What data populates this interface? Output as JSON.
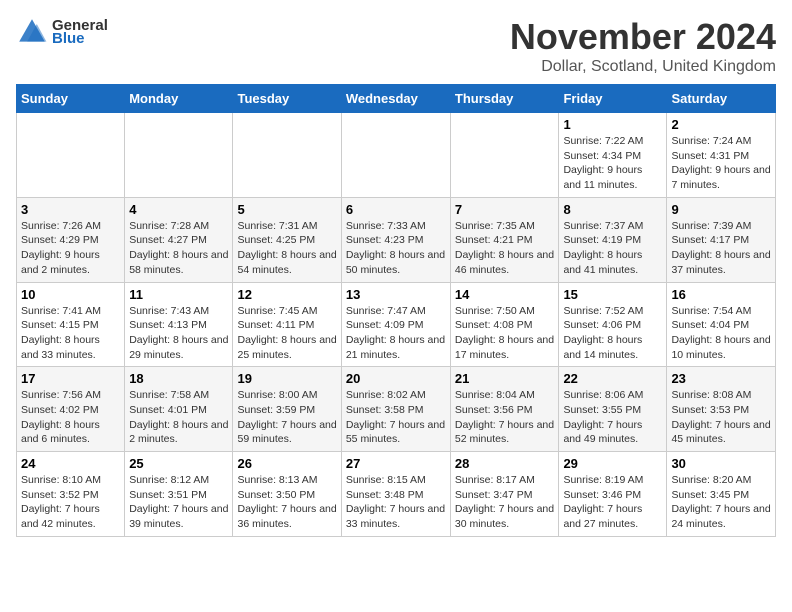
{
  "header": {
    "logo_general": "General",
    "logo_blue": "Blue",
    "month_title": "November 2024",
    "location": "Dollar, Scotland, United Kingdom"
  },
  "days_of_week": [
    "Sunday",
    "Monday",
    "Tuesday",
    "Wednesday",
    "Thursday",
    "Friday",
    "Saturday"
  ],
  "weeks": [
    [
      {
        "day": "",
        "info": ""
      },
      {
        "day": "",
        "info": ""
      },
      {
        "day": "",
        "info": ""
      },
      {
        "day": "",
        "info": ""
      },
      {
        "day": "",
        "info": ""
      },
      {
        "day": "1",
        "info": "Sunrise: 7:22 AM\nSunset: 4:34 PM\nDaylight: 9 hours and 11 minutes."
      },
      {
        "day": "2",
        "info": "Sunrise: 7:24 AM\nSunset: 4:31 PM\nDaylight: 9 hours and 7 minutes."
      }
    ],
    [
      {
        "day": "3",
        "info": "Sunrise: 7:26 AM\nSunset: 4:29 PM\nDaylight: 9 hours and 2 minutes."
      },
      {
        "day": "4",
        "info": "Sunrise: 7:28 AM\nSunset: 4:27 PM\nDaylight: 8 hours and 58 minutes."
      },
      {
        "day": "5",
        "info": "Sunrise: 7:31 AM\nSunset: 4:25 PM\nDaylight: 8 hours and 54 minutes."
      },
      {
        "day": "6",
        "info": "Sunrise: 7:33 AM\nSunset: 4:23 PM\nDaylight: 8 hours and 50 minutes."
      },
      {
        "day": "7",
        "info": "Sunrise: 7:35 AM\nSunset: 4:21 PM\nDaylight: 8 hours and 46 minutes."
      },
      {
        "day": "8",
        "info": "Sunrise: 7:37 AM\nSunset: 4:19 PM\nDaylight: 8 hours and 41 minutes."
      },
      {
        "day": "9",
        "info": "Sunrise: 7:39 AM\nSunset: 4:17 PM\nDaylight: 8 hours and 37 minutes."
      }
    ],
    [
      {
        "day": "10",
        "info": "Sunrise: 7:41 AM\nSunset: 4:15 PM\nDaylight: 8 hours and 33 minutes."
      },
      {
        "day": "11",
        "info": "Sunrise: 7:43 AM\nSunset: 4:13 PM\nDaylight: 8 hours and 29 minutes."
      },
      {
        "day": "12",
        "info": "Sunrise: 7:45 AM\nSunset: 4:11 PM\nDaylight: 8 hours and 25 minutes."
      },
      {
        "day": "13",
        "info": "Sunrise: 7:47 AM\nSunset: 4:09 PM\nDaylight: 8 hours and 21 minutes."
      },
      {
        "day": "14",
        "info": "Sunrise: 7:50 AM\nSunset: 4:08 PM\nDaylight: 8 hours and 17 minutes."
      },
      {
        "day": "15",
        "info": "Sunrise: 7:52 AM\nSunset: 4:06 PM\nDaylight: 8 hours and 14 minutes."
      },
      {
        "day": "16",
        "info": "Sunrise: 7:54 AM\nSunset: 4:04 PM\nDaylight: 8 hours and 10 minutes."
      }
    ],
    [
      {
        "day": "17",
        "info": "Sunrise: 7:56 AM\nSunset: 4:02 PM\nDaylight: 8 hours and 6 minutes."
      },
      {
        "day": "18",
        "info": "Sunrise: 7:58 AM\nSunset: 4:01 PM\nDaylight: 8 hours and 2 minutes."
      },
      {
        "day": "19",
        "info": "Sunrise: 8:00 AM\nSunset: 3:59 PM\nDaylight: 7 hours and 59 minutes."
      },
      {
        "day": "20",
        "info": "Sunrise: 8:02 AM\nSunset: 3:58 PM\nDaylight: 7 hours and 55 minutes."
      },
      {
        "day": "21",
        "info": "Sunrise: 8:04 AM\nSunset: 3:56 PM\nDaylight: 7 hours and 52 minutes."
      },
      {
        "day": "22",
        "info": "Sunrise: 8:06 AM\nSunset: 3:55 PM\nDaylight: 7 hours and 49 minutes."
      },
      {
        "day": "23",
        "info": "Sunrise: 8:08 AM\nSunset: 3:53 PM\nDaylight: 7 hours and 45 minutes."
      }
    ],
    [
      {
        "day": "24",
        "info": "Sunrise: 8:10 AM\nSunset: 3:52 PM\nDaylight: 7 hours and 42 minutes."
      },
      {
        "day": "25",
        "info": "Sunrise: 8:12 AM\nSunset: 3:51 PM\nDaylight: 7 hours and 39 minutes."
      },
      {
        "day": "26",
        "info": "Sunrise: 8:13 AM\nSunset: 3:50 PM\nDaylight: 7 hours and 36 minutes."
      },
      {
        "day": "27",
        "info": "Sunrise: 8:15 AM\nSunset: 3:48 PM\nDaylight: 7 hours and 33 minutes."
      },
      {
        "day": "28",
        "info": "Sunrise: 8:17 AM\nSunset: 3:47 PM\nDaylight: 7 hours and 30 minutes."
      },
      {
        "day": "29",
        "info": "Sunrise: 8:19 AM\nSunset: 3:46 PM\nDaylight: 7 hours and 27 minutes."
      },
      {
        "day": "30",
        "info": "Sunrise: 8:20 AM\nSunset: 3:45 PM\nDaylight: 7 hours and 24 minutes."
      }
    ]
  ]
}
